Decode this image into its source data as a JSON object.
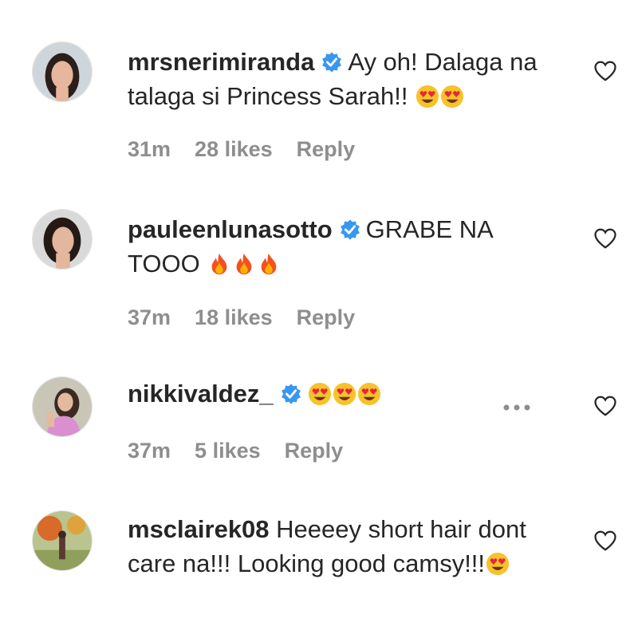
{
  "comments": [
    {
      "username": "mrsnerimiranda",
      "text": "Ay oh! Dalaga na talaga si Princess Sarah!!",
      "emoji": [
        "heart-eyes",
        "heart-eyes"
      ],
      "time": "31m",
      "likes": "28 likes",
      "reply": "Reply",
      "avatar_bg": "#cfd6db"
    },
    {
      "username": "pauleenlunasotto",
      "text": "GRABE NA TOOO",
      "emoji": [
        "fire",
        "fire",
        "fire"
      ],
      "time": "37m",
      "likes": "18 likes",
      "reply": "Reply",
      "avatar_bg": "#d9d9d9"
    },
    {
      "username": "nikkivaldez_",
      "text": "",
      "emoji": [
        "heart-eyes",
        "heart-eyes",
        "heart-eyes"
      ],
      "time": "37m",
      "likes": "5 likes",
      "reply": "Reply",
      "avatar_bg": "#c9c6b8"
    },
    {
      "username": "msclairek08",
      "text": "Heeeey short hair dont care na!!! Looking good camsy!!!",
      "emoji": [
        "heart-eyes"
      ],
      "time": "",
      "likes": "",
      "reply": "",
      "avatar_bg": "#b9c48e"
    }
  ],
  "colors": {
    "text": "#262626",
    "meta": "#8e8e8e",
    "verified": "#3897f0"
  }
}
